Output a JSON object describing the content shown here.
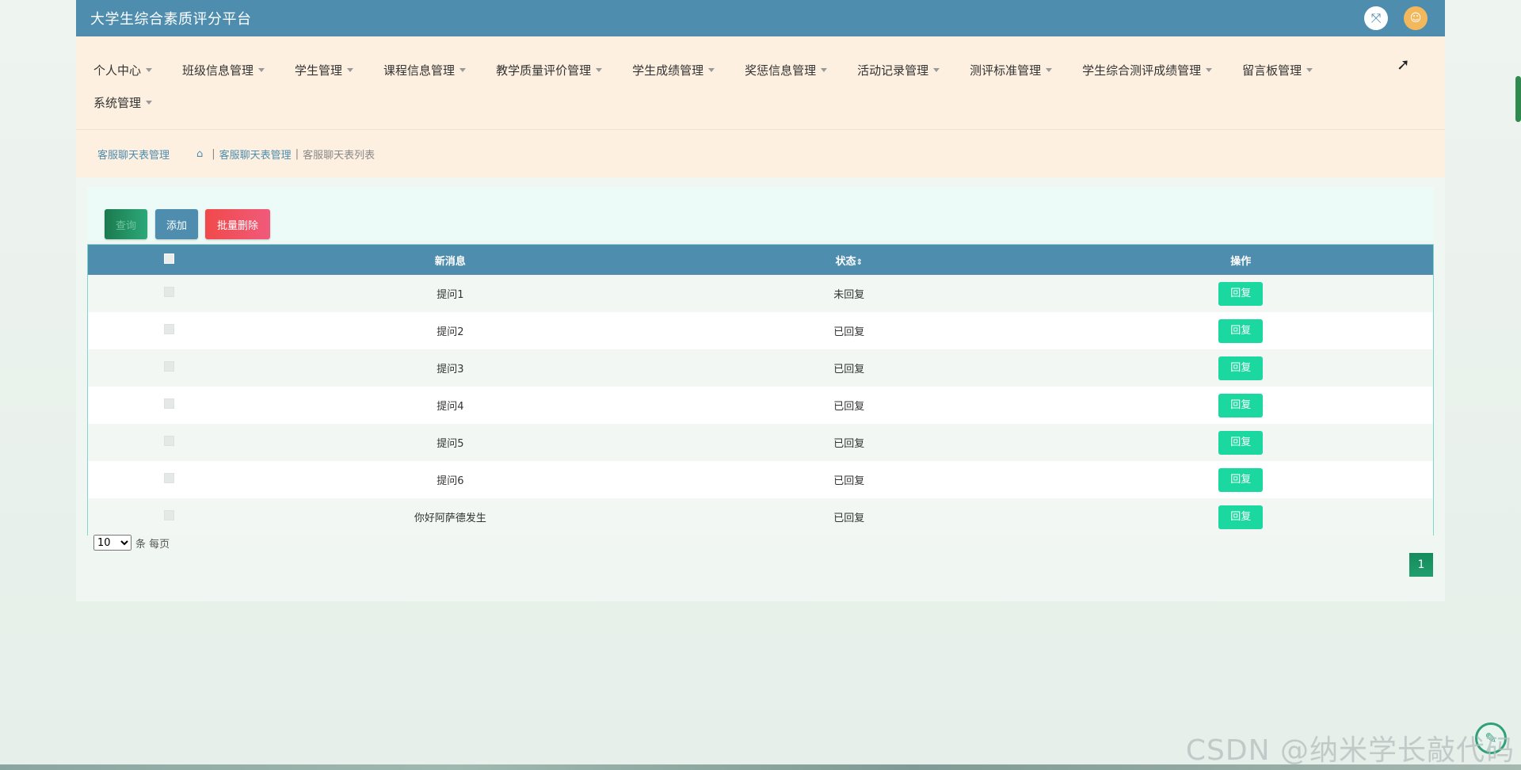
{
  "header": {
    "title": "大学生综合素质评分平台"
  },
  "nav": {
    "items": [
      {
        "label": "个人中心"
      },
      {
        "label": "班级信息管理"
      },
      {
        "label": "学生管理"
      },
      {
        "label": "课程信息管理"
      },
      {
        "label": "教学质量评价管理"
      },
      {
        "label": "学生成绩管理"
      },
      {
        "label": "奖惩信息管理"
      },
      {
        "label": "活动记录管理"
      },
      {
        "label": "测评标准管理"
      },
      {
        "label": "学生综合测评成绩管理"
      },
      {
        "label": "留言板管理"
      },
      {
        "label": "系统管理"
      }
    ]
  },
  "breadcrumb": {
    "title": "客服聊天表管理",
    "link": "客服聊天表管理",
    "current": "客服聊天表列表",
    "separator": "|"
  },
  "toolbar": {
    "search_label": "查询",
    "add_label": "添加",
    "batch_delete_label": "批量删除"
  },
  "table": {
    "headers": {
      "message": "新消息",
      "status": "状态",
      "sort_symbol": "⇕",
      "action": "操作"
    },
    "rows": [
      {
        "message": "提问1",
        "status": "未回复",
        "action": "回复"
      },
      {
        "message": "提问2",
        "status": "已回复",
        "action": "回复"
      },
      {
        "message": "提问3",
        "status": "已回复",
        "action": "回复"
      },
      {
        "message": "提问4",
        "status": "已回复",
        "action": "回复"
      },
      {
        "message": "提问5",
        "status": "已回复",
        "action": "回复"
      },
      {
        "message": "提问6",
        "status": "已回复",
        "action": "回复"
      },
      {
        "message": "你好阿萨德发生",
        "status": "已回复",
        "action": "回复"
      }
    ]
  },
  "pagination": {
    "page_size": "10",
    "page_size_suffix": "条 每页",
    "current_page": "1"
  },
  "watermark": "CSDN @纳米学长敲代码",
  "colors": {
    "primary": "#4e8dae",
    "nav_bg": "#fdf0e0",
    "reply": "#1ad8a0",
    "danger": "#f04a4a",
    "page": "#168a5a"
  }
}
